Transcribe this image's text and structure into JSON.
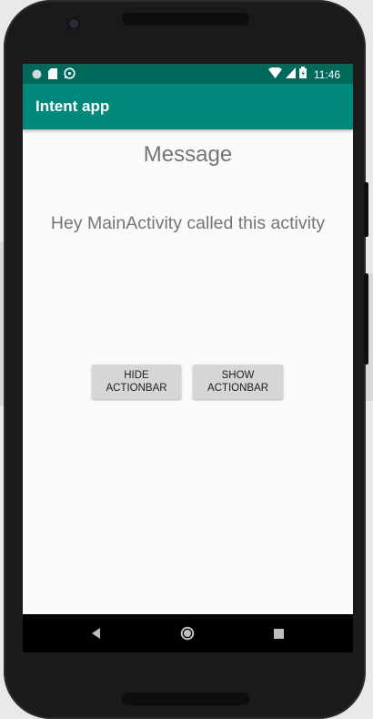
{
  "status_bar": {
    "time": "11:46",
    "left_icons": [
      "circle-notification-icon",
      "sd-card-icon",
      "whatsapp-icon"
    ],
    "right_icons": [
      "wifi-icon",
      "cell-signal-icon",
      "battery-icon"
    ]
  },
  "action_bar": {
    "title": "Intent app"
  },
  "content": {
    "heading": "Message",
    "body": "Hey MainActivity called this activity"
  },
  "buttons": {
    "hide": "HIDE\nACTIONBAR",
    "show": "SHOW\nACTIONBAR"
  },
  "colors": {
    "status_bar": "#00695c",
    "action_bar": "#00897b",
    "screen_bg": "#fafafa",
    "text_gray": "#757575",
    "button_bg": "#d6d6d6"
  },
  "navigation": [
    "back-icon",
    "home-icon",
    "recents-icon"
  ]
}
